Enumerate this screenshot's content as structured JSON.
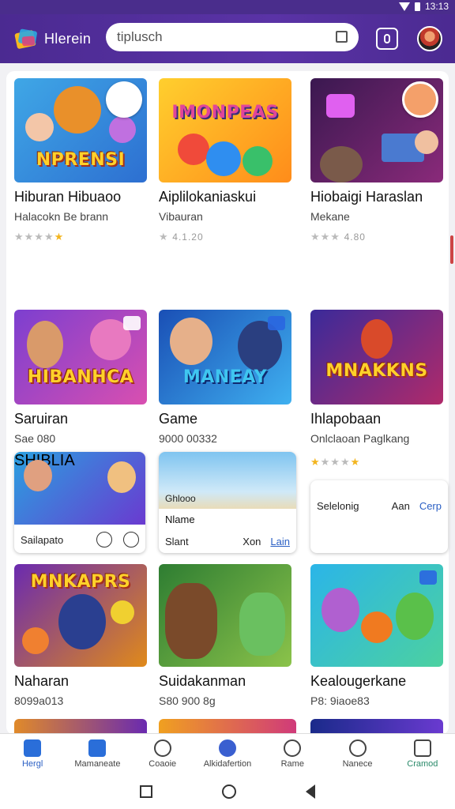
{
  "status_bar": {
    "time": "13:13"
  },
  "header": {
    "app_name": "Hlerein",
    "search_value": "tiplusch"
  },
  "cards": [
    {
      "title_art": "NPRENSI",
      "name": "Hiburan Hibuaoo",
      "sub": "Halacokn  Be brann",
      "stars_on": 1,
      "stars_text": "",
      "colors": [
        "#3fa7e6",
        "#2d6fd1"
      ]
    },
    {
      "title_art": "IMONPEAS",
      "name": "Aiplilokaniaskui",
      "sub": "Vibauran",
      "stars_on": 0,
      "stars_text": "4.1.20",
      "colors": [
        "#ffcf2e",
        "#ff8c1a"
      ]
    },
    {
      "title_art": "",
      "name": "Hiobaigi Haraslan",
      "sub": "Mekane",
      "stars_on": 0,
      "stars_text": "4.80",
      "colors": [
        "#3a1850",
        "#8a2a7a"
      ]
    },
    {
      "title_art": "HIBANHCA",
      "name": "Saruiran",
      "sub": "Sae 080",
      "stars_on": 0,
      "stars_text": "",
      "colors": [
        "#7c3fd0",
        "#d94fb0"
      ]
    },
    {
      "title_art": "MANEAY",
      "name": "Game",
      "sub": "9000 00332",
      "stars_on": 0,
      "stars_text": "",
      "colors": [
        "#1a4fb5",
        "#3fb0f0"
      ]
    },
    {
      "title_art": "MNAKKNS",
      "name": "Ihlapobaan",
      "sub": "Onlclaoan Paglkang",
      "stars_on": 2,
      "stars_text": "",
      "colors": [
        "#3a2a9a",
        "#b02a6a"
      ]
    },
    {
      "title_art": "MNKAPRS",
      "name": "Naharan",
      "sub": "8099a013",
      "stars_on": 0,
      "stars_text": "",
      "colors": [
        "#6a2ab0",
        "#e08a1a"
      ]
    },
    {
      "title_art": "",
      "name": "Suidakanman",
      "sub": "S80 900 8g",
      "stars_on": 0,
      "stars_text": "",
      "colors": [
        "#2e7d32",
        "#8bc34a"
      ]
    },
    {
      "title_art": "",
      "name": "Kealougerkane",
      "sub": "P8: 9iaoe83",
      "stars_on": 0,
      "stars_text": "",
      "colors": [
        "#2bb5e8",
        "#4cd1a0"
      ]
    }
  ],
  "mini_cards": [
    {
      "art": "SHIBLIA",
      "label": "Sailapato"
    },
    {
      "art": "",
      "title": "Ghlooo",
      "name": "Nlame",
      "sub": "Slant",
      "action1": "Xon",
      "action2": "Lain"
    },
    {
      "label": "Selelonig",
      "action1": "Aan",
      "action2": "Cerp"
    }
  ],
  "tabs": [
    {
      "label": "Hergl",
      "active": true
    },
    {
      "label": "Mamaneate",
      "active": false
    },
    {
      "label": "Coaoie",
      "active": false
    },
    {
      "label": "Alkidafertion",
      "active": false
    },
    {
      "label": "Rame",
      "active": false
    },
    {
      "label": "Nanece",
      "active": false
    },
    {
      "label": "Cramod",
      "active": false
    }
  ]
}
